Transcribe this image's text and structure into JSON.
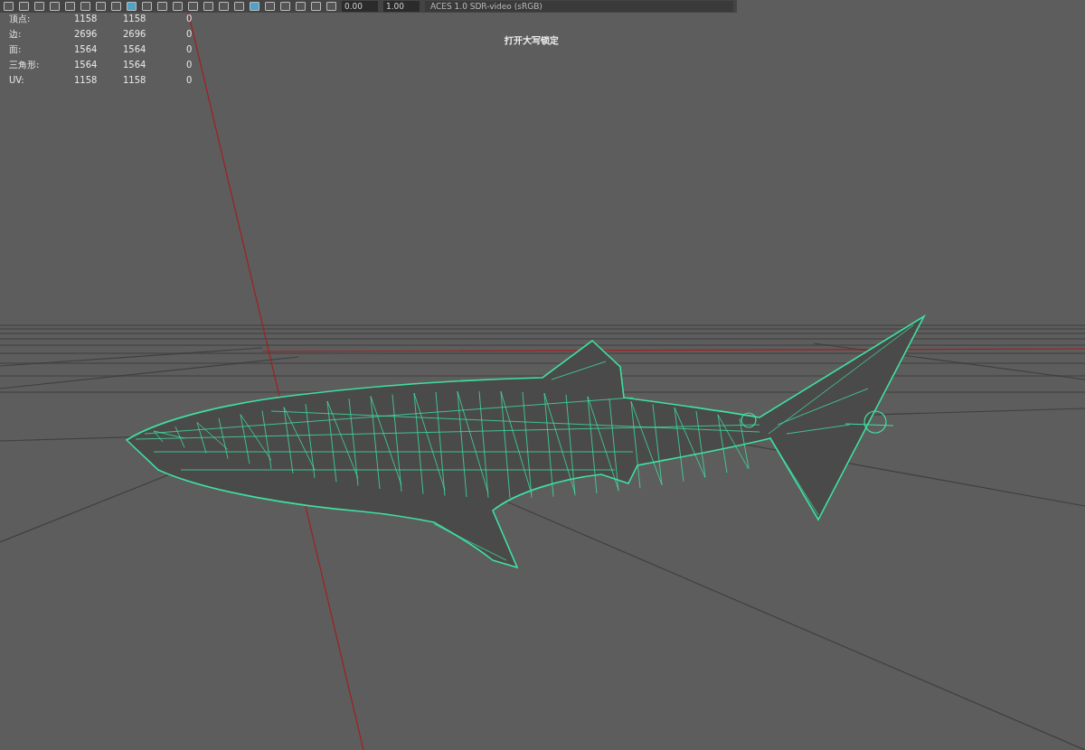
{
  "toolbar": {
    "fields": [
      {
        "value": "0.00"
      },
      {
        "value": "1.00"
      }
    ],
    "color_space": "ACES 1.0 SDR-video (sRGB)"
  },
  "stats": [
    {
      "label": "顶点:",
      "values": [
        "1158",
        "1158",
        "0"
      ]
    },
    {
      "label": "边:",
      "values": [
        "2696",
        "2696",
        "0"
      ]
    },
    {
      "label": "面:",
      "values": [
        "1564",
        "1564",
        "0"
      ]
    },
    {
      "label": "三角形:",
      "values": [
        "1564",
        "1564",
        "0"
      ]
    },
    {
      "label": "UV:",
      "values": [
        "1158",
        "1158",
        "0"
      ]
    }
  ],
  "notice": "打开大写锁定"
}
